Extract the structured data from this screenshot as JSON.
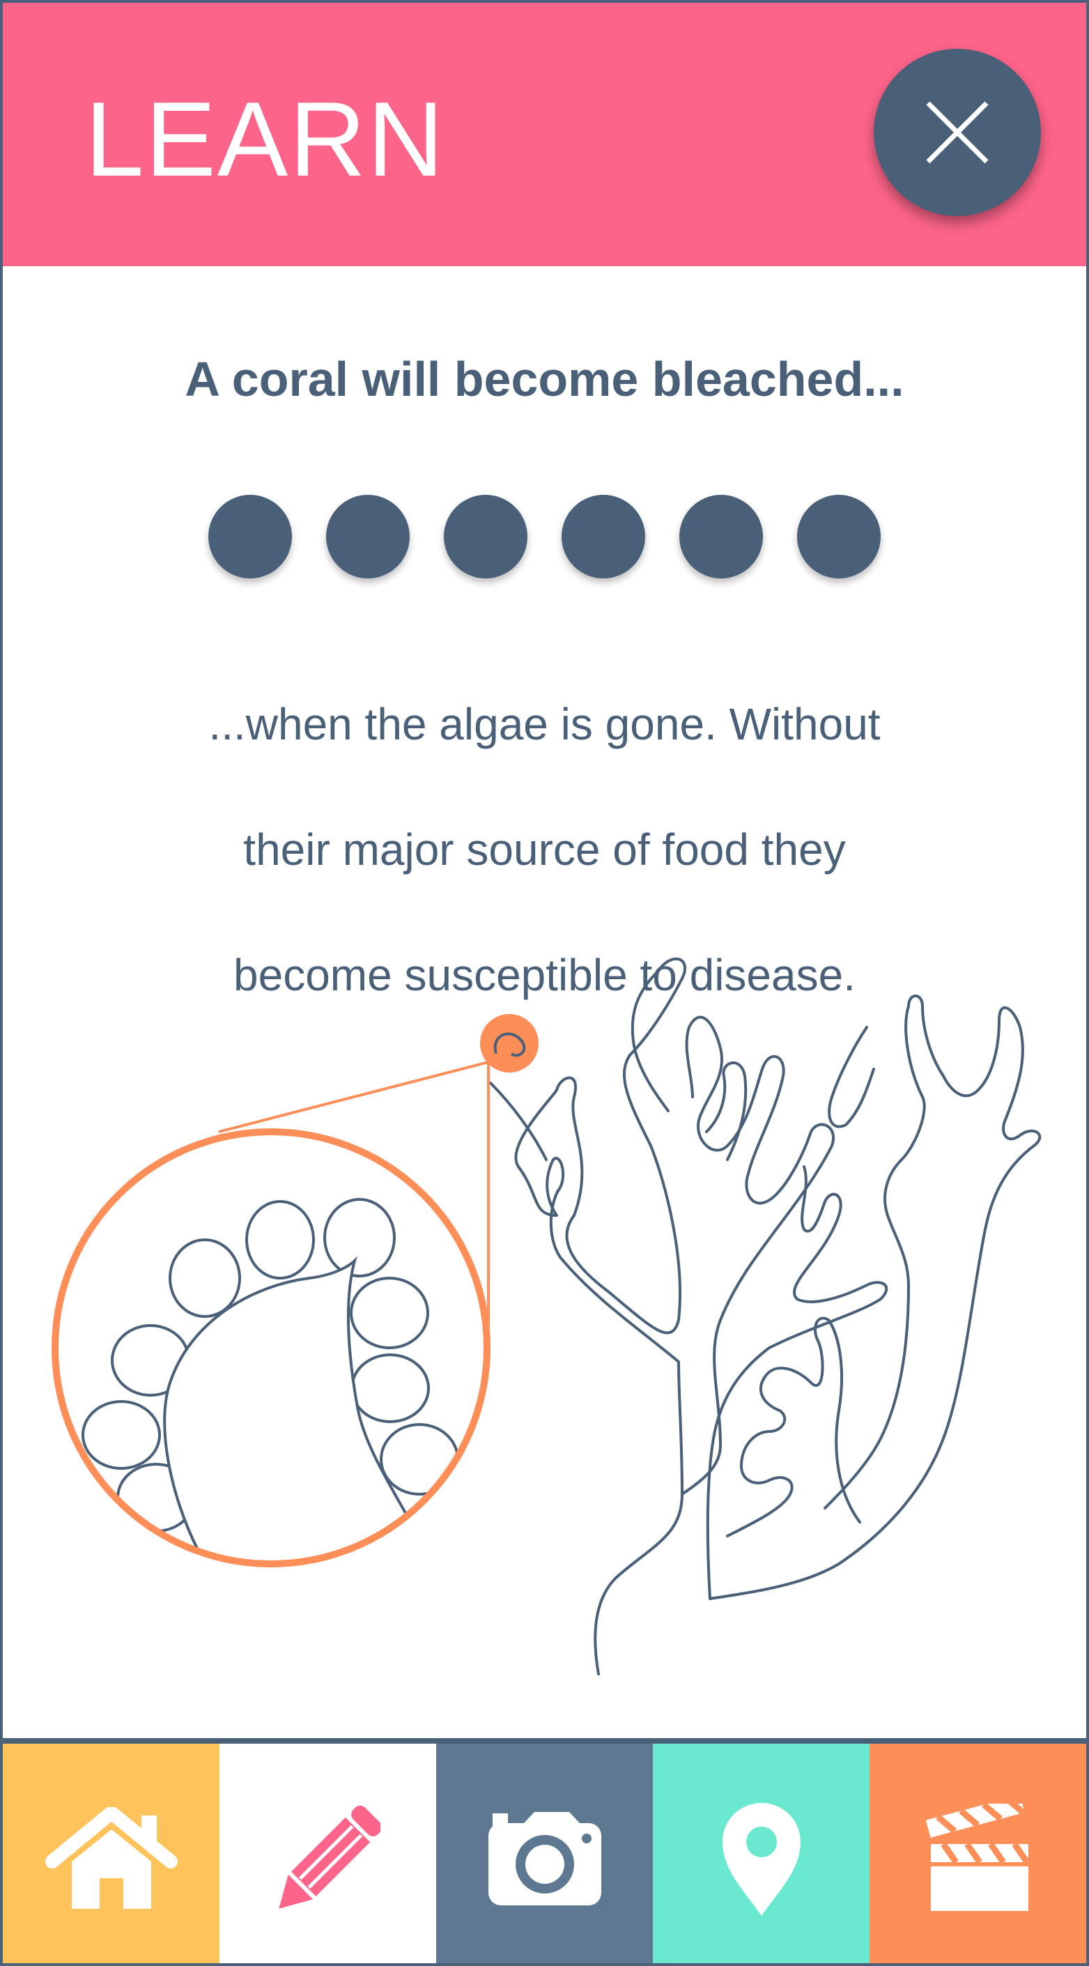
{
  "header": {
    "title": "LEARN",
    "close_label": "X",
    "background": "#fd6489"
  },
  "content": {
    "headline": "A coral will become bleached...",
    "progress": {
      "total": 6,
      "filled": 6
    },
    "body_lines": [
      "...when the algae is gone. Without",
      "their major source of food they",
      "become susceptible to disease."
    ],
    "illustration": {
      "subject": "coral-branch",
      "detail": "coral-polyp-with-algae-zoom"
    }
  },
  "navbar": {
    "items": [
      {
        "name": "home",
        "icon": "home-icon",
        "color": "#fec35b"
      },
      {
        "name": "learn",
        "icon": "pencil-icon",
        "color": "#ffffff"
      },
      {
        "name": "camera",
        "icon": "camera-icon",
        "color": "#5e7892"
      },
      {
        "name": "map",
        "icon": "location-pin-icon",
        "color": "#6ae8d0"
      },
      {
        "name": "video",
        "icon": "clapperboard-icon",
        "color": "#fe8e58"
      }
    ]
  },
  "colors": {
    "primary_dark": "#4a6078",
    "accent_pink": "#fd6489",
    "accent_orange": "#fe8e58"
  }
}
